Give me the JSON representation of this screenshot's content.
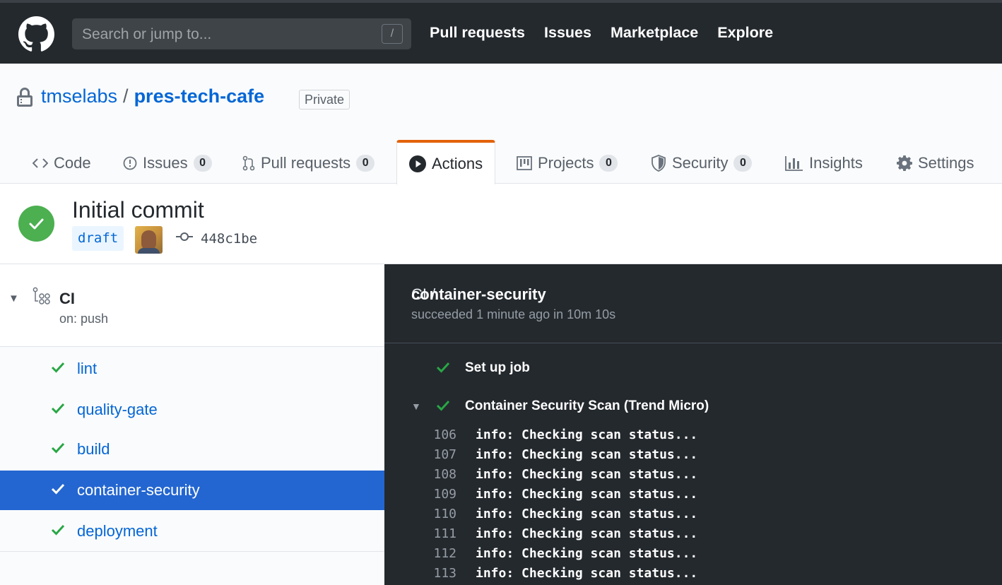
{
  "header": {
    "search_placeholder": "Search or jump to...",
    "search_shortcut": "/",
    "nav": [
      "Pull requests",
      "Issues",
      "Marketplace",
      "Explore"
    ]
  },
  "repo": {
    "owner": "tmselabs",
    "separator": "/",
    "name": "pres-tech-cafe",
    "visibility": "Private"
  },
  "tabs": [
    {
      "label": "Code",
      "icon": "code-icon"
    },
    {
      "label": "Issues",
      "icon": "issue-icon",
      "count": "0"
    },
    {
      "label": "Pull requests",
      "icon": "pull-request-icon",
      "count": "0"
    },
    {
      "label": "Actions",
      "icon": "play-icon",
      "selected": true
    },
    {
      "label": "Projects",
      "icon": "project-icon",
      "count": "0"
    },
    {
      "label": "Security",
      "icon": "shield-icon",
      "count": "0"
    },
    {
      "label": "Insights",
      "icon": "graph-icon"
    },
    {
      "label": "Settings",
      "icon": "gear-icon"
    }
  ],
  "run": {
    "title": "Initial commit",
    "branch": "draft",
    "sha": "448c1be",
    "status": "success"
  },
  "workflow": {
    "name": "CI",
    "trigger": "on: push",
    "jobs": [
      {
        "name": "lint",
        "status": "success"
      },
      {
        "name": "quality-gate",
        "status": "success"
      },
      {
        "name": "build",
        "status": "success"
      },
      {
        "name": "container-security",
        "status": "success",
        "active": true
      },
      {
        "name": "deployment",
        "status": "success"
      }
    ]
  },
  "log": {
    "workflow": "CI /",
    "job": "container-security",
    "summary": "succeeded 1 minute ago in 10m 10s",
    "steps": [
      {
        "name": "Set up job",
        "expanded": false
      },
      {
        "name": "Container Security Scan (Trend Micro)",
        "expanded": true
      }
    ],
    "lines": [
      {
        "num": "106",
        "text": "info: Checking scan status..."
      },
      {
        "num": "107",
        "text": "info: Checking scan status..."
      },
      {
        "num": "108",
        "text": "info: Checking scan status..."
      },
      {
        "num": "109",
        "text": "info: Checking scan status..."
      },
      {
        "num": "110",
        "text": "info: Checking scan status..."
      },
      {
        "num": "111",
        "text": "info: Checking scan status..."
      },
      {
        "num": "112",
        "text": "info: Checking scan status..."
      },
      {
        "num": "113",
        "text": "info: Checking scan status..."
      }
    ]
  },
  "colors": {
    "header_bg": "#24292e",
    "link": "#0366d6",
    "success": "#28a745",
    "selected_tab_accent": "#e36209",
    "active_job_bg": "#2366d1",
    "log_bg": "#24292e"
  }
}
